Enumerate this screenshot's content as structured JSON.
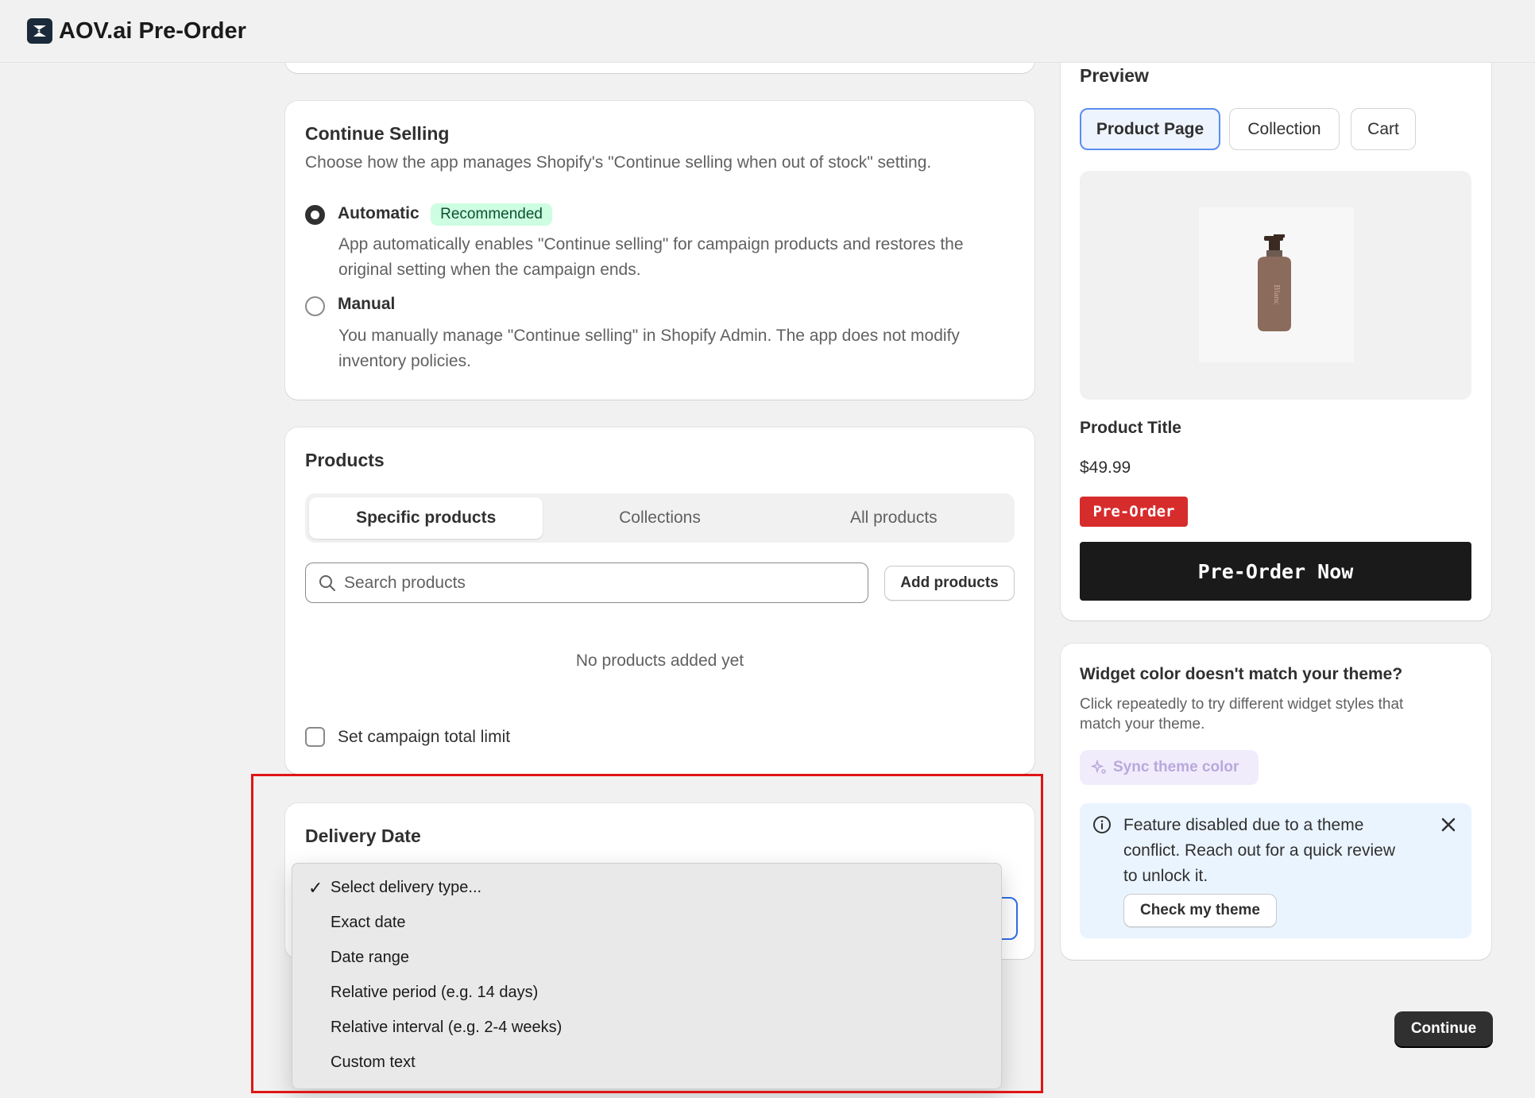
{
  "app": {
    "title": "AOV.ai Pre-Order"
  },
  "continue_selling": {
    "title": "Continue Selling",
    "description": "Choose how the app manages Shopify's \"Continue selling when out of stock\" setting.",
    "options": [
      {
        "label": "Automatic",
        "badge": "Recommended",
        "selected": true,
        "description_line1": "App automatically enables \"Continue selling\" for campaign products and restores the",
        "description_line2": "original setting when the campaign ends."
      },
      {
        "label": "Manual",
        "selected": false,
        "description_line1": "You manually manage \"Continue selling\" in Shopify Admin. The app does not modify",
        "description_line2": "inventory policies."
      }
    ]
  },
  "products": {
    "title": "Products",
    "tabs": [
      {
        "label": "Specific products",
        "active": true
      },
      {
        "label": "Collections",
        "active": false
      },
      {
        "label": "All products",
        "active": false
      }
    ],
    "search_placeholder": "Search products",
    "add_button": "Add products",
    "empty_text": "No products added yet",
    "limit_label": "Set campaign total limit"
  },
  "delivery": {
    "title": "Delivery Date",
    "options": [
      {
        "label": "Select delivery type...",
        "selected": true
      },
      {
        "label": "Exact date",
        "selected": false
      },
      {
        "label": "Date range",
        "selected": false
      },
      {
        "label": "Relative period (e.g. 14 days)",
        "selected": false
      },
      {
        "label": "Relative interval (e.g. 2-4 weeks)",
        "selected": false
      },
      {
        "label": "Custom text",
        "selected": false
      }
    ],
    "check_mark": "✓"
  },
  "preview": {
    "title": "Preview",
    "tabs": [
      {
        "label": "Product Page",
        "active": true
      },
      {
        "label": "Collection",
        "active": false
      },
      {
        "label": "Cart",
        "active": false
      }
    ],
    "bottle_label": "Blanc",
    "product_title": "Product Title",
    "price": "$49.99",
    "badge": "Pre-Order",
    "button": "Pre-Order Now"
  },
  "widget_color": {
    "title": "Widget color doesn't match your theme?",
    "description_line1": "Click repeatedly to try different widget styles that",
    "description_line2": "match your theme.",
    "sync_button": "Sync theme color",
    "info_line1": "Feature disabled due to a theme",
    "info_line2": "conflict. Reach out for a quick review",
    "info_line3": "to unlock it.",
    "check_button": "Check my theme"
  },
  "footer": {
    "continue_button": "Continue"
  },
  "colors": {
    "accent": "#5b8def",
    "badge_red": "#d72c2c",
    "highlight": "#e01515",
    "recommended_bg": "#cdfee1"
  }
}
